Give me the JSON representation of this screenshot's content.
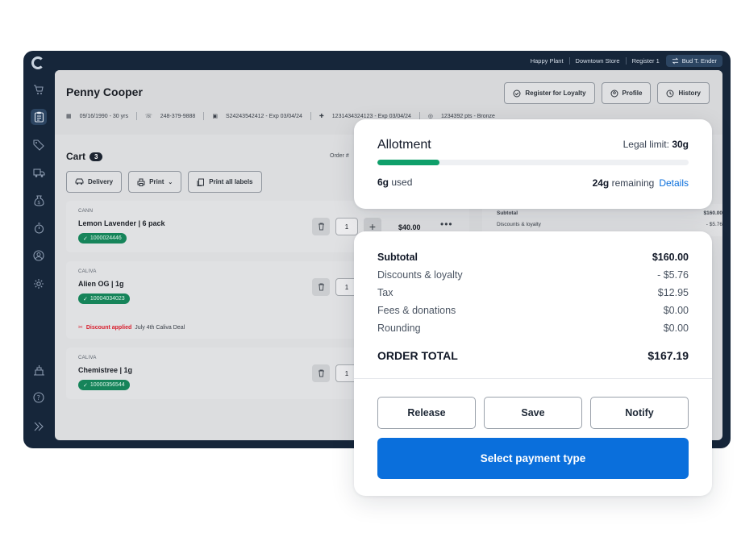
{
  "topbar": {
    "store": "Happy Plant",
    "location": "Downtown Store",
    "register": "Register 1",
    "user": "Bud T. Ender"
  },
  "sidebar": {
    "items": [
      "cart-icon",
      "clipboard-icon",
      "tag-icon",
      "delivery-truck-icon",
      "money-bag-icon",
      "timer-icon",
      "customer-icon",
      "settings-icon",
      "inventory-icon",
      "help-icon",
      "expand-icon"
    ],
    "active": "clipboard-icon"
  },
  "customer": {
    "name": "Penny Cooper",
    "dob": "09/16/1990 - 30 yrs",
    "phone": "248-379-9888",
    "id": "S24243542412 - Exp 03/04/24",
    "medical": "1231434324123 - Exp 03/04/24",
    "loyalty": "1234392 pts - Bronze"
  },
  "header_buttons": {
    "register_loyalty": "Register for Loyalty",
    "profile": "Profile",
    "history": "History"
  },
  "cart": {
    "title": "Cart",
    "count": "3",
    "order_label": "Order #",
    "delivery": "Delivery",
    "print": "Print",
    "print_all": "Print all labels",
    "items": [
      {
        "brand": "CANN",
        "name": "Lemon Lavender | 6 pack",
        "sku": "1000024446",
        "qty": "1",
        "price": "$40.00"
      },
      {
        "brand": "CALIVA",
        "name": "Alien OG | 1g",
        "sku": "10004034023",
        "qty": "1",
        "discount_label": "Discount applied",
        "discount_desc": "July 4th Caliva Deal"
      },
      {
        "brand": "CALIVA",
        "name": "Chemistree | 1g",
        "sku": "10000356544",
        "qty": "1"
      }
    ]
  },
  "bg_summary": {
    "subtotal_label": "Subtotal",
    "subtotal": "$160.00",
    "discounts_label": "Discounts & loyalty",
    "discounts": "- $5.76"
  },
  "allotment": {
    "title": "Allotment",
    "limit_label": "Legal limit:",
    "limit_value": "30g",
    "used_value": "6g",
    "used_label": "used",
    "remaining_value": "24g",
    "remaining_label": "remaining",
    "details": "Details",
    "used_fraction": 0.2,
    "bar_color": "#0f9f6a"
  },
  "summary": {
    "rows": [
      {
        "label": "Subtotal",
        "value": "$160.00"
      },
      {
        "label": "Discounts & loyalty",
        "value": "- $5.76"
      },
      {
        "label": "Tax",
        "value": "$12.95"
      },
      {
        "label": "Fees & donations",
        "value": "$0.00"
      },
      {
        "label": "Rounding",
        "value": "$0.00"
      }
    ],
    "total_label": "ORDER TOTAL",
    "total_value": "$167.19",
    "release": "Release",
    "save": "Save",
    "notify": "Notify",
    "pay": "Select payment type",
    "accent": "#0a6fdc"
  }
}
